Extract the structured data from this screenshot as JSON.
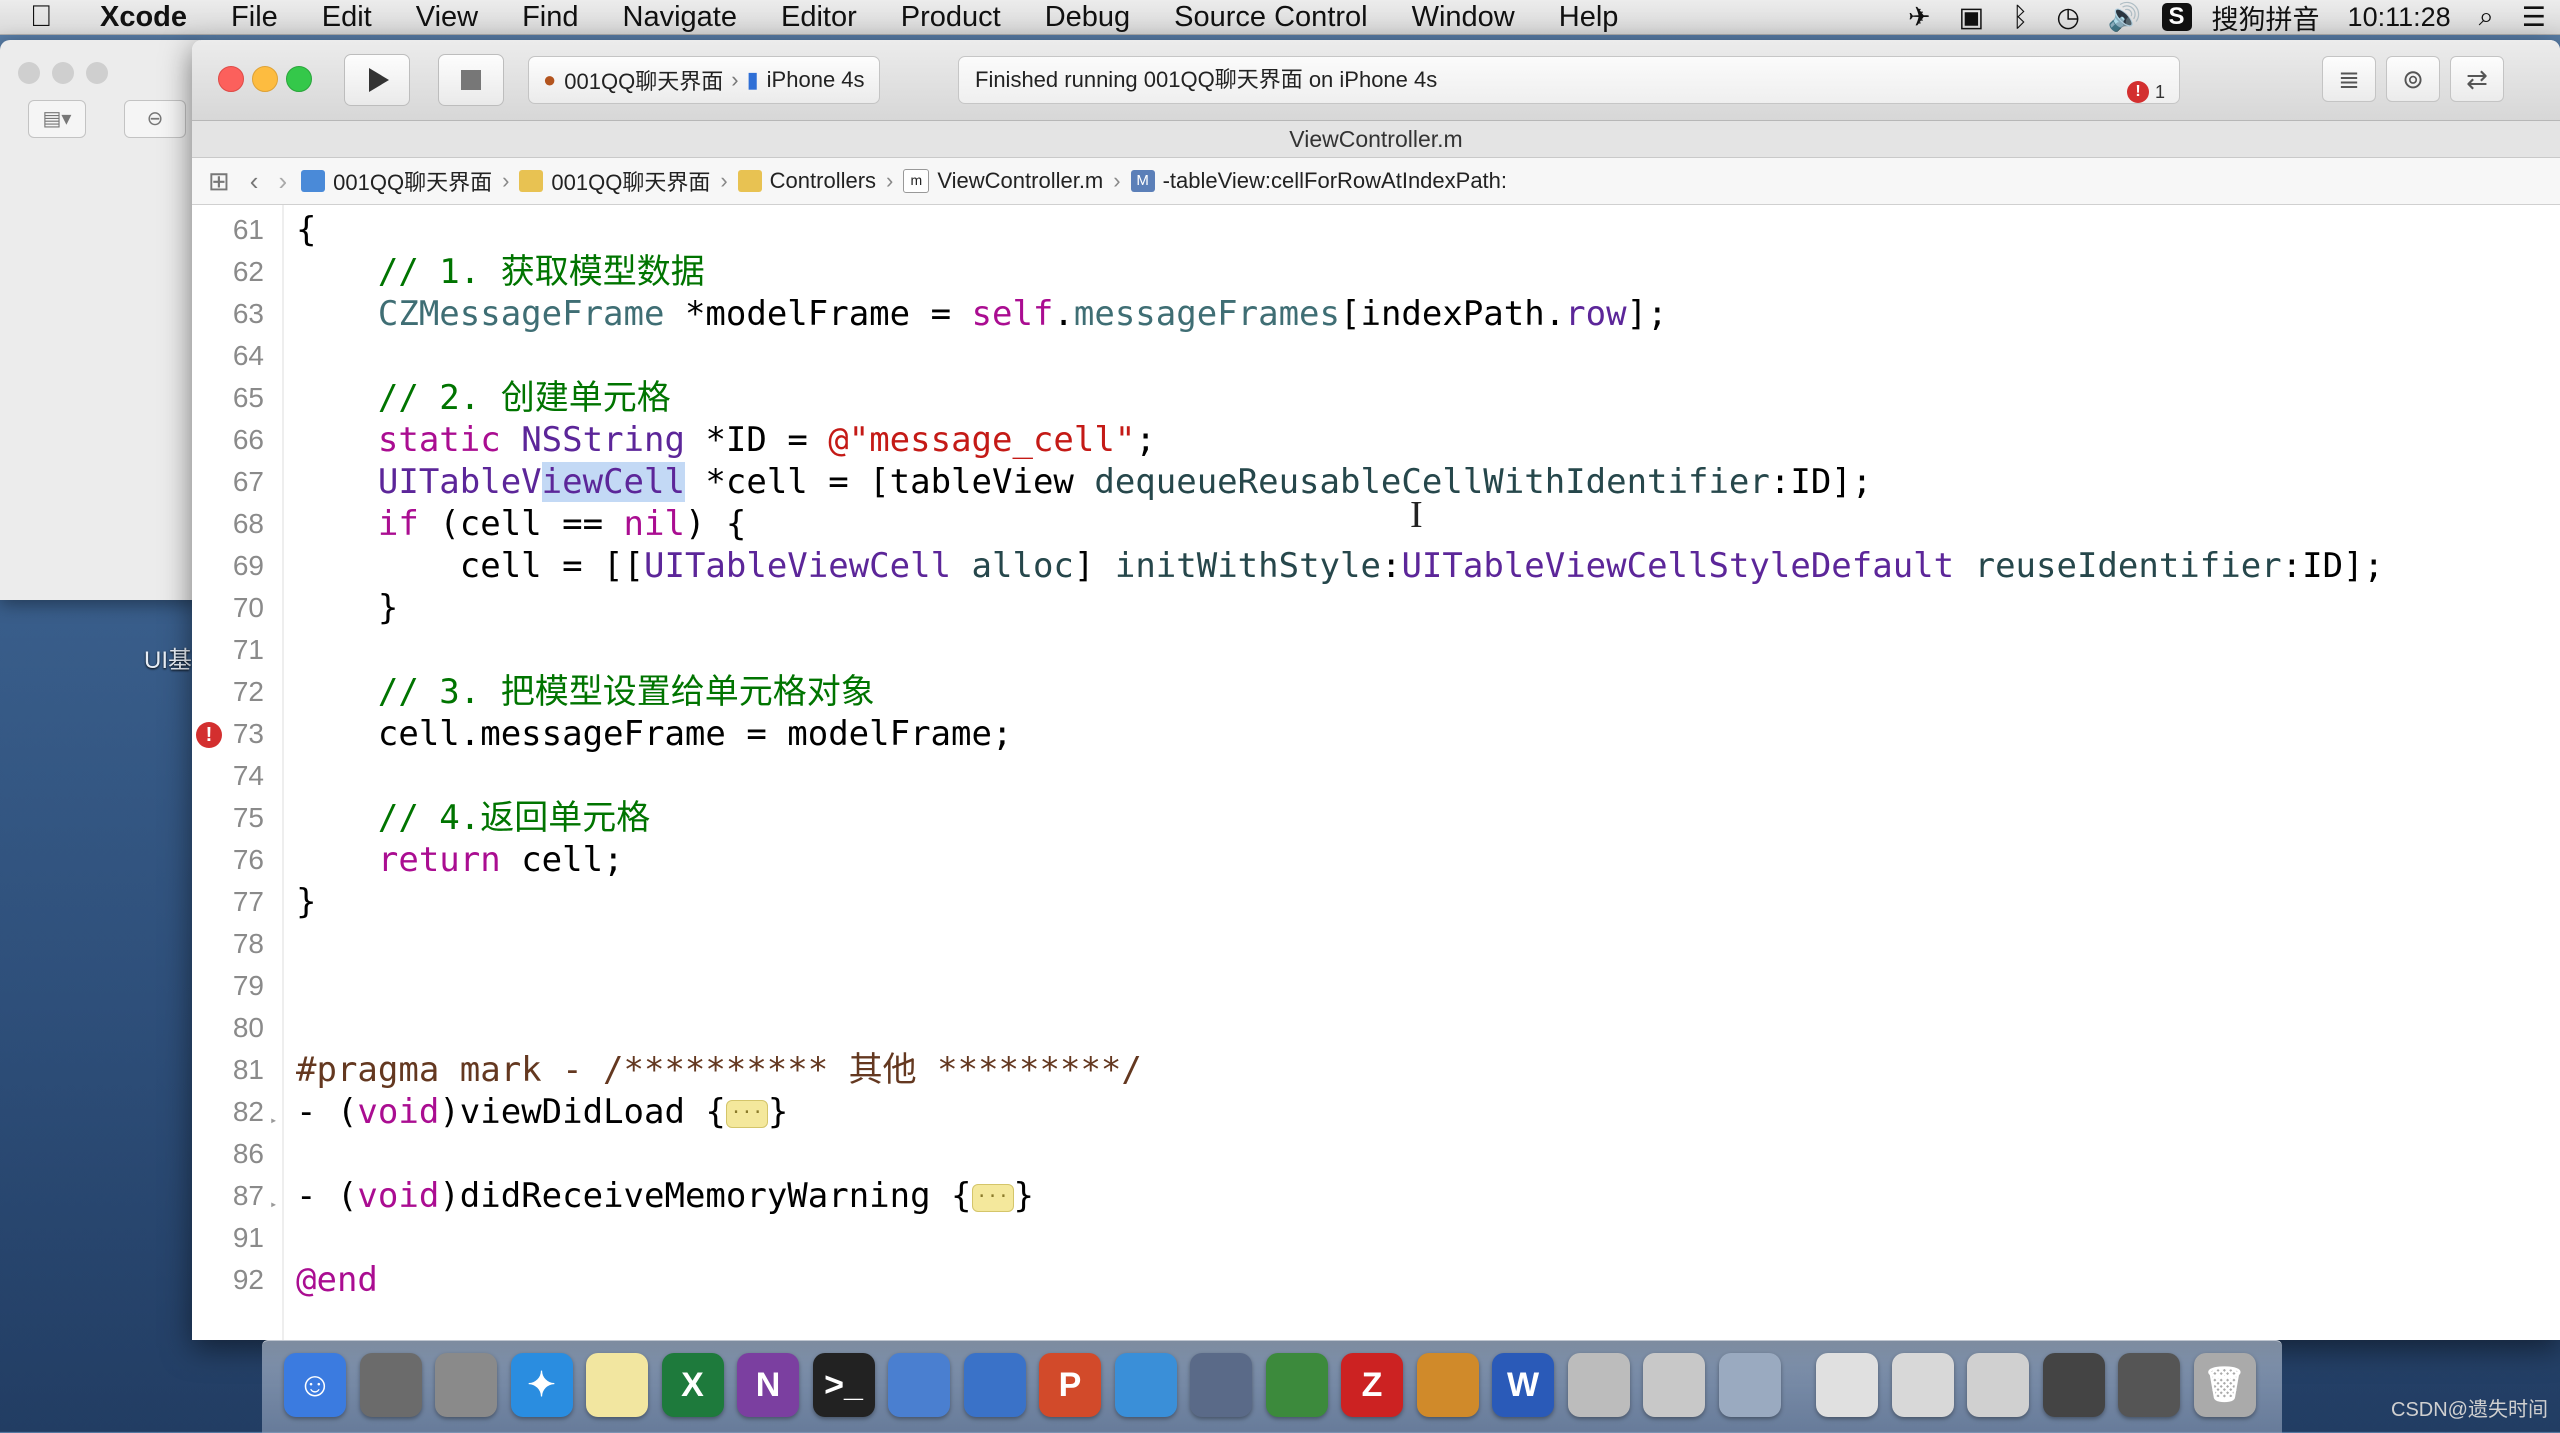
{
  "menubar": {
    "app": "Xcode",
    "items": [
      "File",
      "Edit",
      "View",
      "Find",
      "Navigate",
      "Editor",
      "Product",
      "Debug",
      "Source Control",
      "Window",
      "Help"
    ],
    "input_method": "搜狗拼音",
    "clock": "10:11:28"
  },
  "background_window": {
    "label": "UI基"
  },
  "toolbar": {
    "scheme_target": "001QQ聊天界面",
    "scheme_device": "iPhone 4s",
    "status_text": "Finished running 001QQ聊天界面 on iPhone 4s",
    "issue_count": "1",
    "issue_icon": "!"
  },
  "editor": {
    "file_title": "ViewController.m",
    "breadcrumbs": [
      "001QQ聊天界面",
      "001QQ聊天界面",
      "Controllers",
      "ViewController.m",
      "-tableView:cellForRowAtIndexPath:"
    ],
    "breadcrumb_m_prefix": "m",
    "breadcrumb_method_prefix": "M",
    "error_line": "73",
    "lines": [
      {
        "n": "61",
        "code": "{"
      },
      {
        "n": "62",
        "code": "    // 1. 获取模型数据"
      },
      {
        "n": "63",
        "code": "    CZMessageFrame *modelFrame = self.messageFrames[indexPath.row];"
      },
      {
        "n": "64",
        "code": ""
      },
      {
        "n": "65",
        "code": "    // 2. 创建单元格"
      },
      {
        "n": "66",
        "code": "    static NSString *ID = @\"message_cell\";"
      },
      {
        "n": "67",
        "code": "    UITableViewCell *cell = [tableView dequeueReusableCellWithIdentifier:ID];"
      },
      {
        "n": "68",
        "code": "    if (cell == nil) {"
      },
      {
        "n": "69",
        "code": "        cell = [[UITableViewCell alloc] initWithStyle:UITableViewCellStyleDefault reuseIdentifier:ID];"
      },
      {
        "n": "70",
        "code": "    }"
      },
      {
        "n": "71",
        "code": ""
      },
      {
        "n": "72",
        "code": "    // 3. 把模型设置给单元格对象"
      },
      {
        "n": "73",
        "code": "    cell.messageFrame = modelFrame;"
      },
      {
        "n": "74",
        "code": ""
      },
      {
        "n": "75",
        "code": "    // 4.返回单元格"
      },
      {
        "n": "76",
        "code": "    return cell;"
      },
      {
        "n": "77",
        "code": "}"
      },
      {
        "n": "78",
        "code": ""
      },
      {
        "n": "79",
        "code": ""
      },
      {
        "n": "80",
        "code": ""
      },
      {
        "n": "81",
        "code": "#pragma mark - /********** 其他 *********/"
      },
      {
        "n": "82",
        "code": "- (void)viewDidLoad {…}"
      },
      {
        "n": "86",
        "code": ""
      },
      {
        "n": "87",
        "code": "- (void)didReceiveMemoryWarning {…}"
      },
      {
        "n": "91",
        "code": ""
      },
      {
        "n": "92",
        "code": "@end"
      }
    ]
  },
  "dock": {
    "apps": [
      "finder-icon",
      "system-preferences-icon",
      "launchpad-icon",
      "safari-icon",
      "notes-icon",
      "excel-icon",
      "onenote-icon",
      "terminal-icon",
      "xcode-icon",
      "keynote-folder-icon",
      "powerpoint-icon",
      "instruments-icon",
      "photo-booth-icon",
      "ftp-icon",
      "filezilla-icon",
      "xcode-tools-icon",
      "word-icon",
      "font-app-icon",
      "text-app-icon",
      "preview-icon",
      "mail-icon",
      "documents-icon",
      "downloads-icon",
      "network-icon",
      "display-icon",
      "trash-icon"
    ]
  },
  "watermark": "CSDN@遗失时间",
  "colors": {
    "keyword": "#aa0d91",
    "comment": "#007400",
    "type": "#5c2699",
    "string": "#c41a16",
    "error": "#d32f2f"
  }
}
